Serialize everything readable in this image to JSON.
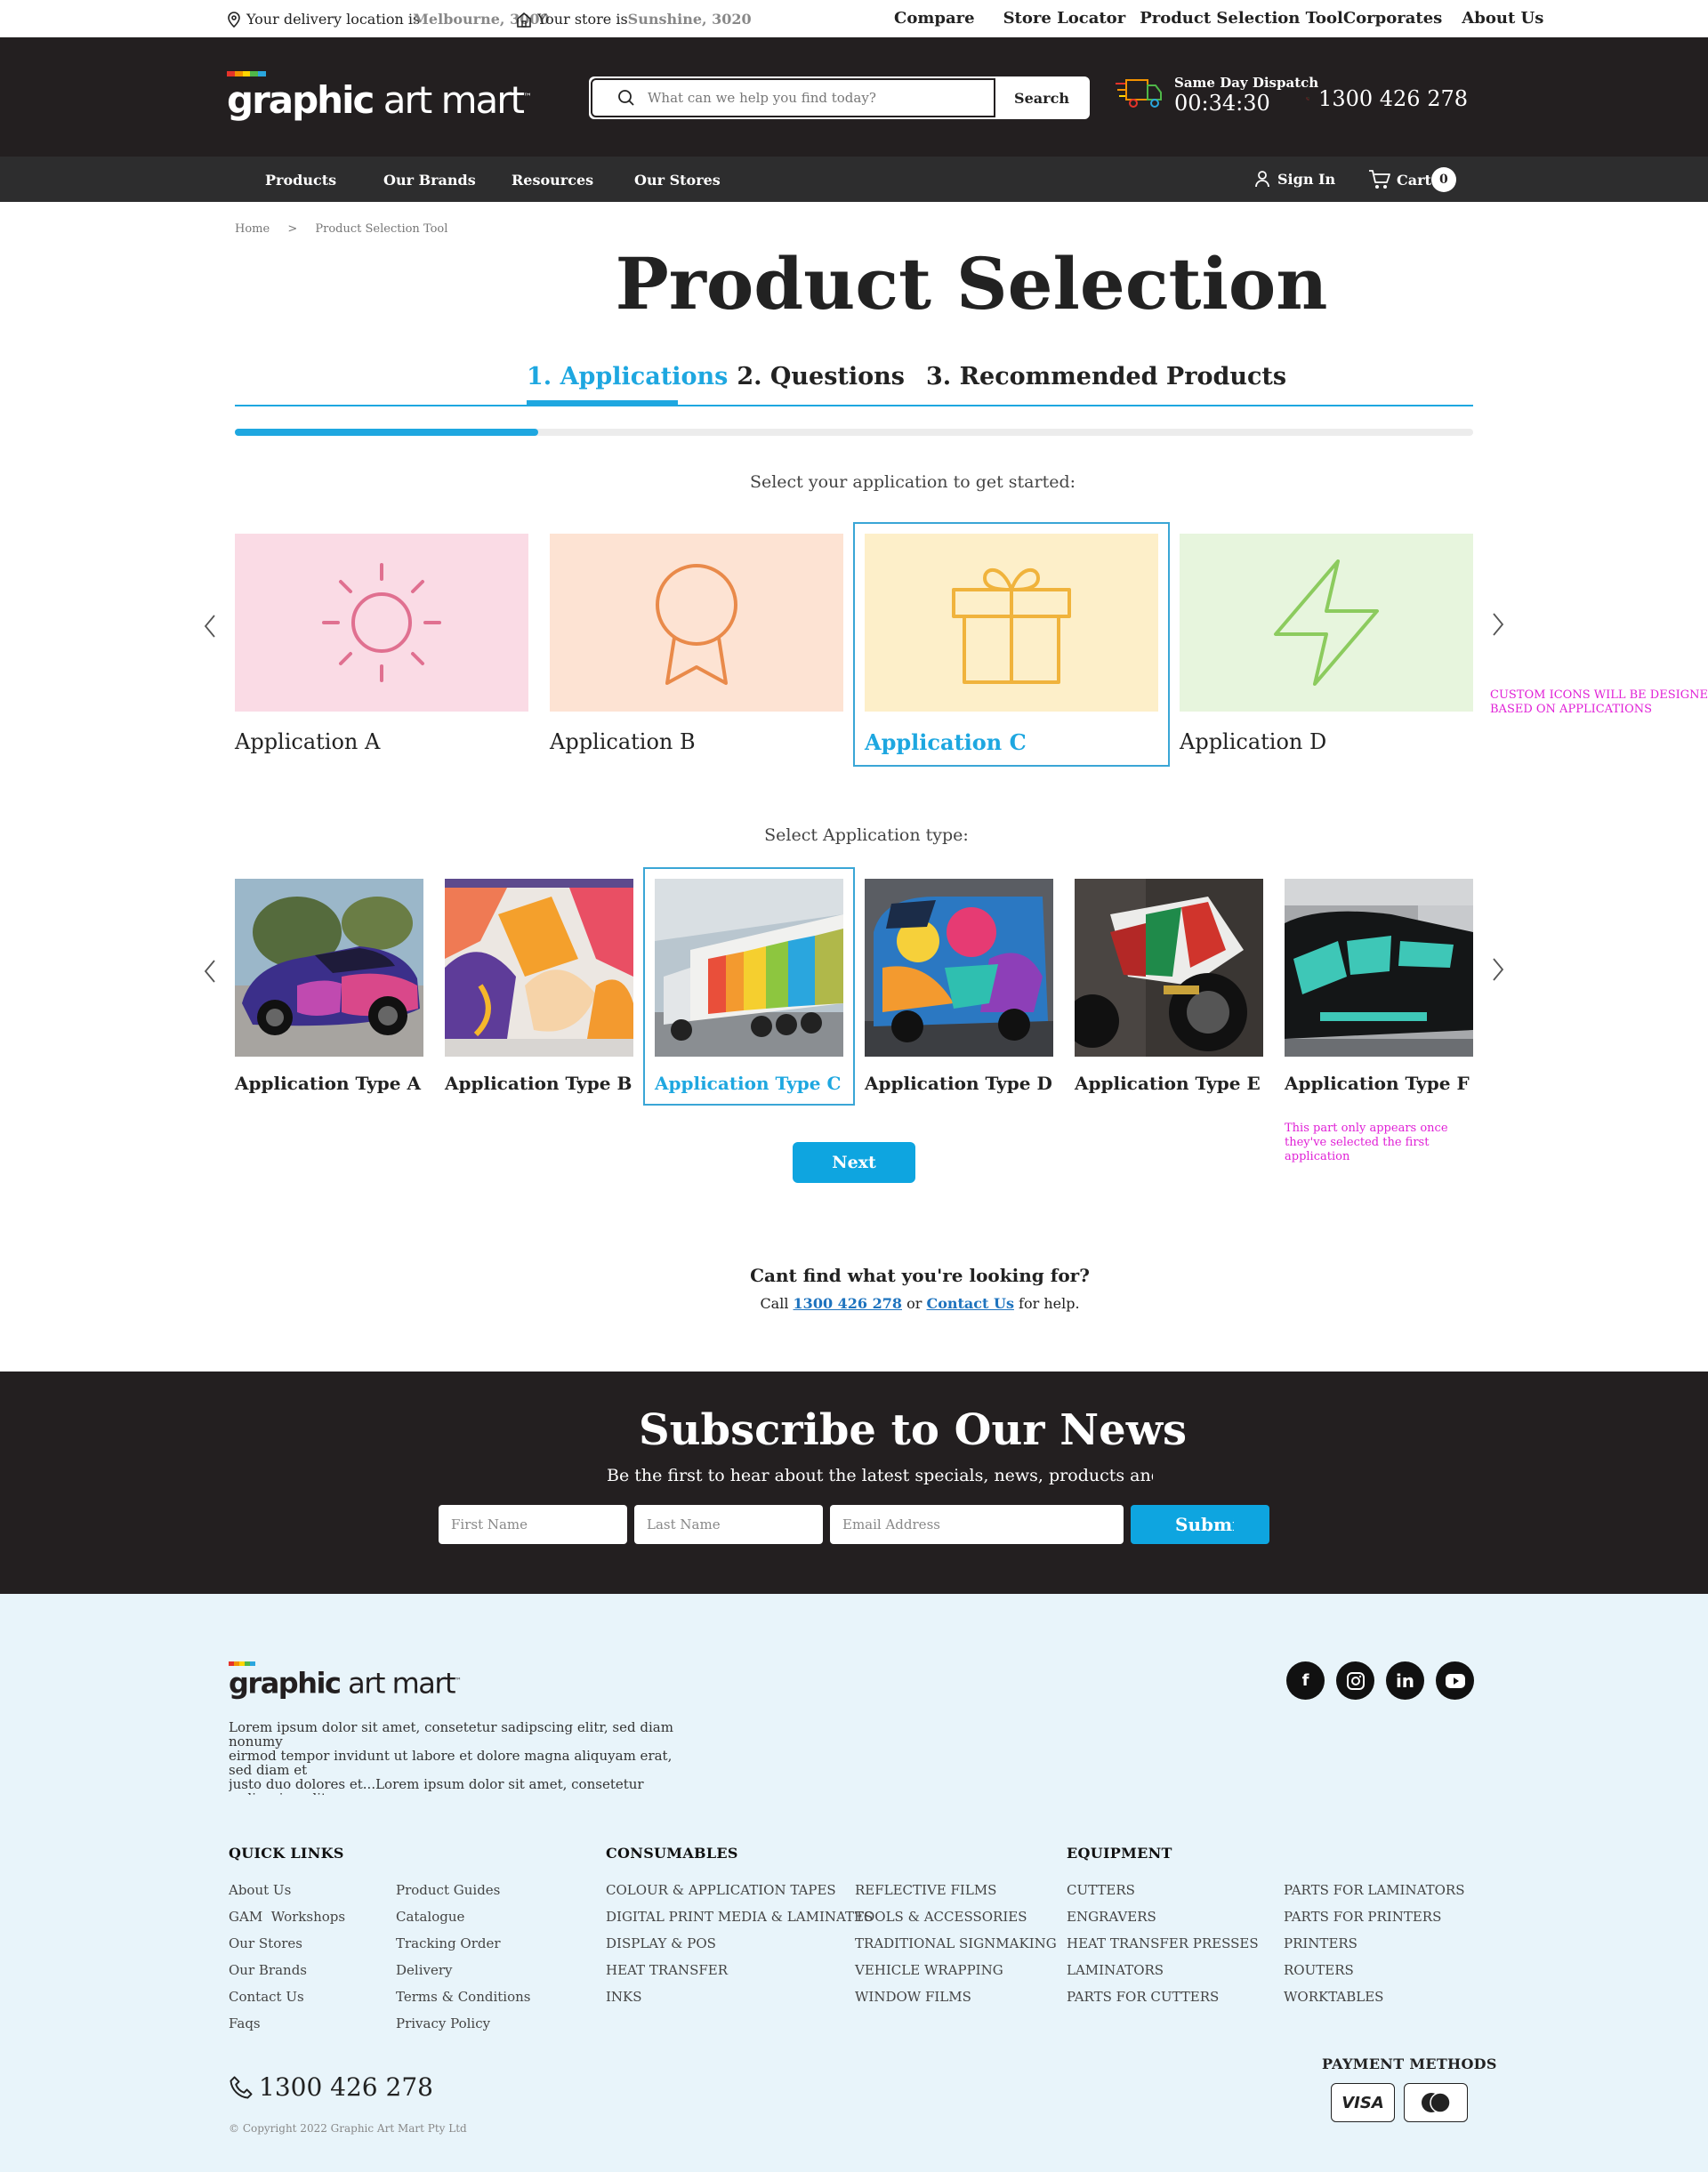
{
  "topbar": {
    "delivery_label": "Your delivery location is",
    "delivery_value": "Melbourne, 3000",
    "store_label": "Your store is",
    "store_value": "Sunshine, 3020",
    "links": [
      "Compare",
      "Store Locator",
      "Product Selection Tool",
      "Corporates",
      "About Us"
    ]
  },
  "header": {
    "logo_bold": "graphic",
    "logo_light": " art mart",
    "logo_colors": [
      "#e5332a",
      "#f39200",
      "#ffd500",
      "#4fb748",
      "#2aa6de"
    ],
    "search_placeholder": "What can we help you find today?",
    "search_button": "Search",
    "dispatch_label": "Same Day Dispatch",
    "dispatch_timer": "00:34:30",
    "phone": "1300 426 278"
  },
  "nav": {
    "items": [
      "Products",
      "Our Brands",
      "Resources",
      "Our Stores"
    ],
    "signin": "Sign In",
    "cart": "Cart",
    "cart_count": "0"
  },
  "breadcrumb": {
    "home": "Home",
    "sep": ">",
    "current": "Product Selection Tool"
  },
  "page_title": "Product Selection",
  "steps": [
    "1. Applications",
    "2. Questions",
    "3. Recommended Products"
  ],
  "progress_fraction": 0.245,
  "applications": {
    "prompt": "Select your application to get started:",
    "items": [
      {
        "label": "Application A",
        "icon": "sun-icon",
        "bg": "#fadbe5",
        "color": "#e07090"
      },
      {
        "label": "Application B",
        "icon": "award-icon",
        "bg": "#fde3d3",
        "color": "#e98a4a"
      },
      {
        "label": "Application C",
        "icon": "gift-icon",
        "bg": "#fdefc9",
        "color": "#f0b33c"
      },
      {
        "label": "Application D",
        "icon": "lightning-icon",
        "bg": "#e7f5dd",
        "color": "#8ccb5e"
      }
    ],
    "selected_index": 2,
    "note": "CUSTOM ICONS WILL BE DESIGNED\nBASED ON APPLICATIONS"
  },
  "application_types": {
    "prompt": "Select Application type:",
    "items": [
      {
        "label": "Application Type A",
        "image": "car-wrap-image"
      },
      {
        "label": "Application Type B",
        "image": "wall-mural-image"
      },
      {
        "label": "Application Type C",
        "image": "truck-wrap-image"
      },
      {
        "label": "Application Type D",
        "image": "van-wrap-image"
      },
      {
        "label": "Application Type E",
        "image": "motorbike-wrap-image"
      },
      {
        "label": "Application Type F",
        "image": "boat-wrap-image"
      }
    ],
    "selected_index": 2,
    "note": "This part only appears once\nthey've selected the first\napplication"
  },
  "next_button": "Next",
  "help": {
    "heading": "Cant find what you're looking for?",
    "call": "Call",
    "phone": "1300 426 278",
    "or": "or",
    "contact": "Contact Us",
    "suffix": "for help."
  },
  "subscribe": {
    "heading": "Subscribe to Our News",
    "text": "Be the first to hear about the latest specials, news, products and events.",
    "first_name": "First Name",
    "last_name": "Last Name",
    "email": "Email Address",
    "submit": "Submit"
  },
  "footer": {
    "logo_bold": "graphic",
    "logo_light": " art mart",
    "about": "Lorem ipsum dolor sit amet, consetetur sadipscing elitr, sed diam nonumy\neirmod tempor invidunt ut labore et dolore magna aliquyam erat, sed diam et\njusto duo dolores et...Lorem ipsum dolor sit amet, consetetur sadipscing elitr,\nsed diam nonumy eirmod tempor invidunt ut labore et dolore magna aliquyam\nerat, sed diam et justo duo dolores et...",
    "social": [
      "facebook-icon",
      "instagram-icon",
      "linkedin-icon",
      "youtube-icon"
    ],
    "quick_links_heading": "QUICK LINKS",
    "quick_links_col1": [
      "About Us",
      "GAM  Workshops",
      "Our Stores",
      "Our Brands",
      "Contact Us",
      "Faqs"
    ],
    "quick_links_col2": [
      "Product Guides",
      "Catalogue",
      "Tracking Order",
      "Delivery",
      "Terms & Conditions",
      "Privacy Policy"
    ],
    "consumables_heading": "CONSUMABLES",
    "consumables_col1": [
      "COLOUR & APPLICATION TAPES",
      "DIGITAL PRINT MEDIA & LAMINATES",
      "DISPLAY & POS",
      "HEAT TRANSFER",
      "INKS"
    ],
    "consumables_col2": [
      "REFLECTIVE FILMS",
      "TOOLS & ACCESSORIES",
      "TRADITIONAL SIGNMAKING",
      "VEHICLE WRAPPING",
      "WINDOW FILMS"
    ],
    "equipment_heading": "EQUIPMENT",
    "equipment_col1": [
      "CUTTERS",
      "ENGRAVERS",
      "HEAT TRANSFER PRESSES",
      "LAMINATORS",
      "PARTS FOR CUTTERS"
    ],
    "equipment_col2": [
      "PARTS FOR LAMINATORS",
      "PARTS FOR PRINTERS",
      "PRINTERS",
      "ROUTERS",
      "WORKTABLES"
    ],
    "phone": "1300 426 278",
    "copyright": "© Copyright 2022 Graphic Art Mart Pty Ltd",
    "payment_heading": "PAYMENT METHODS",
    "payment_visa": "VISA"
  },
  "accent_color": "#1ea7e0"
}
